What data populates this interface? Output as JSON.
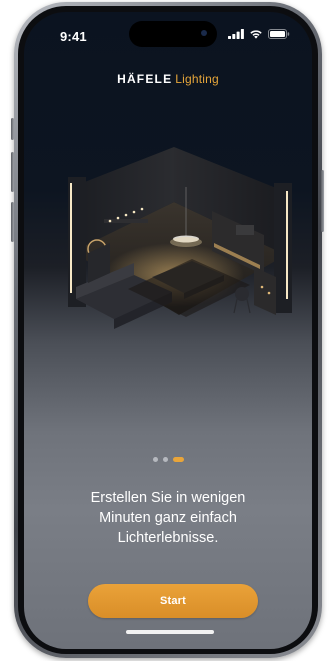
{
  "status_bar": {
    "time": "9:41"
  },
  "brand": {
    "name": "HÄFELE",
    "sub": "Lighting"
  },
  "illustration": {
    "subject": "isometric-room-with-lighting"
  },
  "pagination": {
    "count": 3,
    "active_index": 2
  },
  "onboarding": {
    "headline_line1": "Erstellen Sie in wenigen",
    "headline_line2": "Minuten ganz einfach",
    "headline_line3": "Lichterlebnisse."
  },
  "actions": {
    "start_label": "Start"
  },
  "colors": {
    "accent": "#E9A53A",
    "background_top": "#0B1320",
    "background_bottom": "#6E727A",
    "text": "#FFFFFF"
  },
  "icons": [
    "cellular-signal-icon",
    "wifi-icon",
    "battery-icon"
  ]
}
